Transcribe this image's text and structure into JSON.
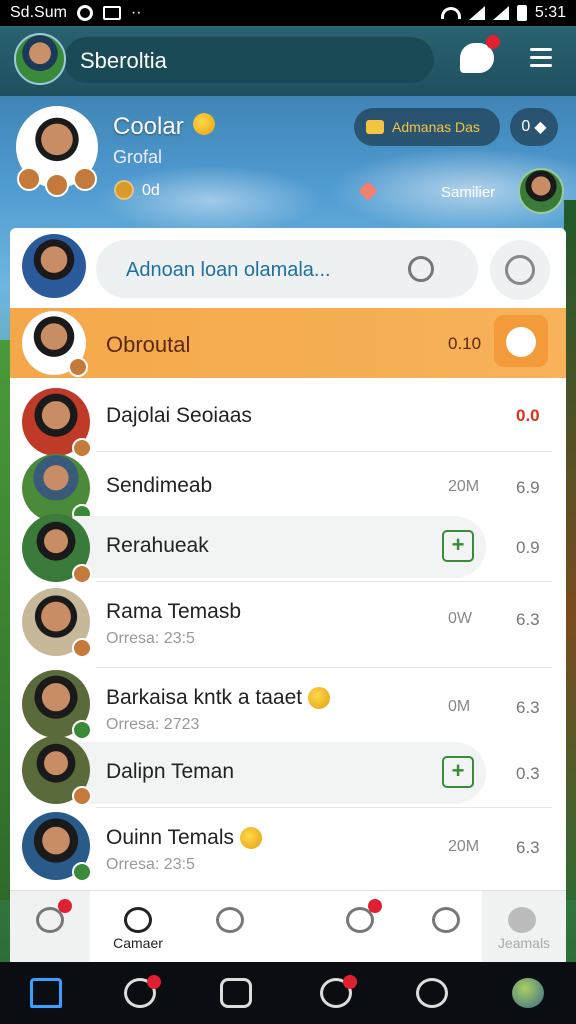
{
  "status_bar": {
    "carrier": "Sd.Sum",
    "time": "5:31"
  },
  "header": {
    "title": "Sberoltia"
  },
  "profile": {
    "name": "Coolar",
    "subtitle": "Grofal",
    "count": "0d",
    "promo": "Admanas Das",
    "stat": "0",
    "friend_label": "Samilier"
  },
  "search": {
    "placeholder": "Adnoan loan olamala..."
  },
  "highlight": {
    "name": "Obroutal",
    "value": "0.10"
  },
  "contacts": [
    {
      "name": "Dajolai Seoiaas",
      "sub": "",
      "mid": "",
      "num": "0.0",
      "num_red": true
    },
    {
      "name": "Sendimeab",
      "sub": "",
      "mid": "20M",
      "num": "6.9"
    },
    {
      "name": "Rerahueak",
      "sub": "",
      "mid": "",
      "num": "0.9",
      "sub_row": true
    },
    {
      "name": "Rama Temasb",
      "sub": "Orresa: 23:5",
      "mid": "0W",
      "num": "6.3"
    },
    {
      "name": "Barkaisa kntk a taaet",
      "sub": "Orresa: 2723",
      "mid": "0M",
      "num": "6.3"
    },
    {
      "name": "Dalipn Teman",
      "sub": "",
      "mid": "",
      "num": "0.3",
      "sub_row": true
    },
    {
      "name": "Ouinn Temals",
      "sub": "Orresa: 23:5",
      "mid": "20M",
      "num": "6.3"
    }
  ],
  "tabs": [
    {
      "label": ""
    },
    {
      "label": "Camaer"
    },
    {
      "label": ""
    },
    {
      "label": ""
    },
    {
      "label": ""
    },
    {
      "label": ""
    },
    {
      "label": "Jeamals"
    }
  ],
  "colors": {
    "accent": "#f5a84a",
    "header": "#1f5060",
    "add_green": "#3a8a3a",
    "badge_red": "#e02030"
  }
}
